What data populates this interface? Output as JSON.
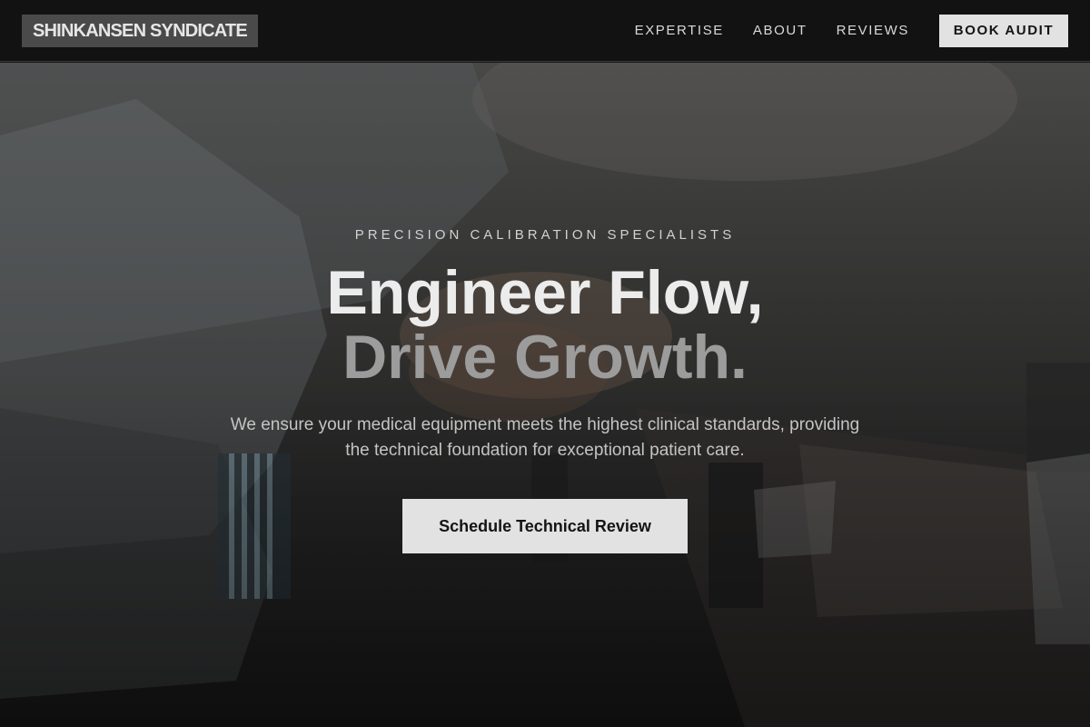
{
  "brand": {
    "name": "SHINKANSEN SYNDICATE"
  },
  "nav": {
    "links": [
      {
        "label": "EXPERTISE"
      },
      {
        "label": "ABOUT"
      },
      {
        "label": "REVIEWS"
      }
    ],
    "cta_label": "BOOK AUDIT"
  },
  "hero": {
    "eyebrow": "PRECISION CALIBRATION SPECIALISTS",
    "headline_line1": "Engineer Flow,",
    "headline_line2": "Drive Growth.",
    "subtitle": "We ensure your medical equipment meets the highest clinical standards, providing the technical foundation for exceptional patient care.",
    "cta_label": "Schedule Technical Review",
    "background_image": "handshake-photo"
  },
  "colors": {
    "navbar_bg": "#121212",
    "logo_bg": "#4a4a4a",
    "button_bg": "#e2e2e2",
    "button_text": "#141414",
    "headline_primary": "#ececec",
    "headline_secondary": "#9c9c9c"
  }
}
